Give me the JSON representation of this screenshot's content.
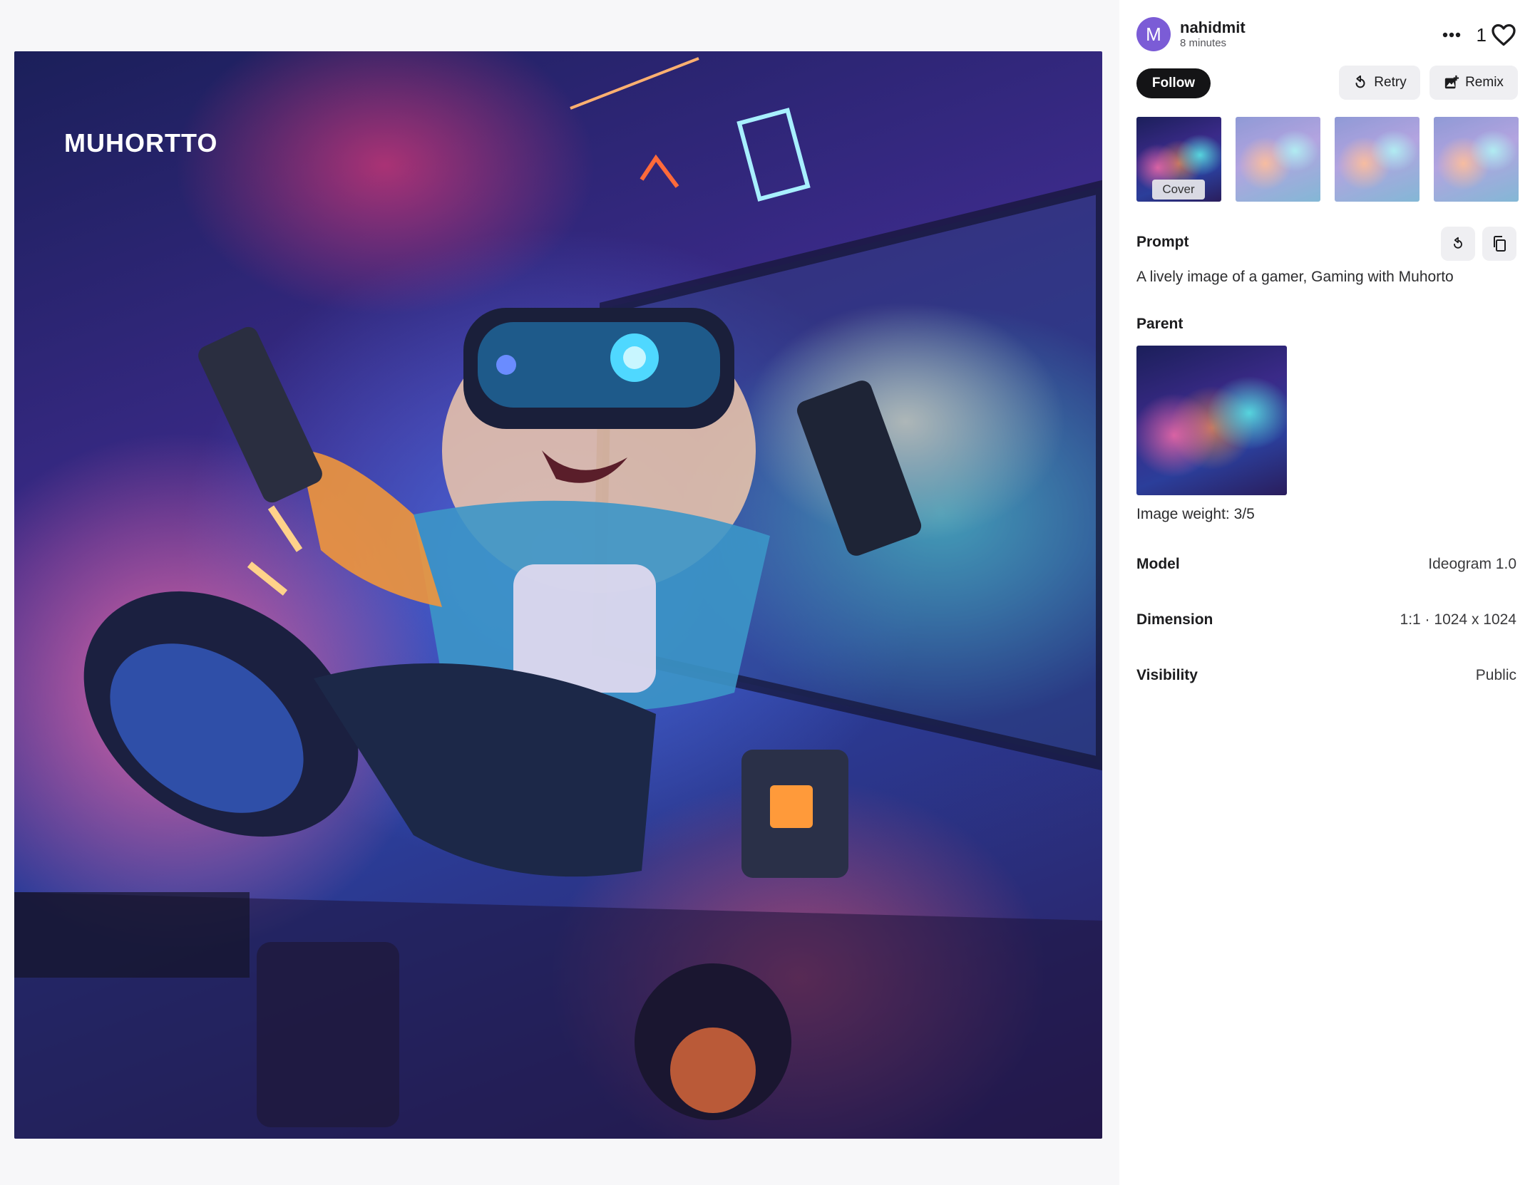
{
  "image": {
    "watermark": "MUHORTTO",
    "alt": "A lively image of a gamer, Gaming with Muhorto"
  },
  "user": {
    "avatar_letter": "M",
    "name": "nahidmit",
    "time": "8 minutes"
  },
  "likes": {
    "count": "1"
  },
  "actions": {
    "follow": "Follow",
    "retry": "Retry",
    "remix": "Remix"
  },
  "thumbnails": {
    "cover_label": "Cover",
    "count": 4
  },
  "prompt": {
    "title": "Prompt",
    "text": "A lively image of a gamer, Gaming with Muhorto"
  },
  "parent": {
    "title": "Parent",
    "weight": "Image weight: 3/5"
  },
  "details": {
    "model_label": "Model",
    "model_value": "Ideogram 1.0",
    "dimension_label": "Dimension",
    "dimension_value": "1:1 · 1024 x 1024",
    "visibility_label": "Visibility",
    "visibility_value": "Public"
  },
  "colors": {
    "avatar": "#7b5cd6",
    "follow_bg": "#141416",
    "button_bg": "#efeff2"
  },
  "icons": [
    "more-icon",
    "heart-icon",
    "retry-icon",
    "remix-icon",
    "reuse-prompt-icon",
    "copy-icon"
  ]
}
